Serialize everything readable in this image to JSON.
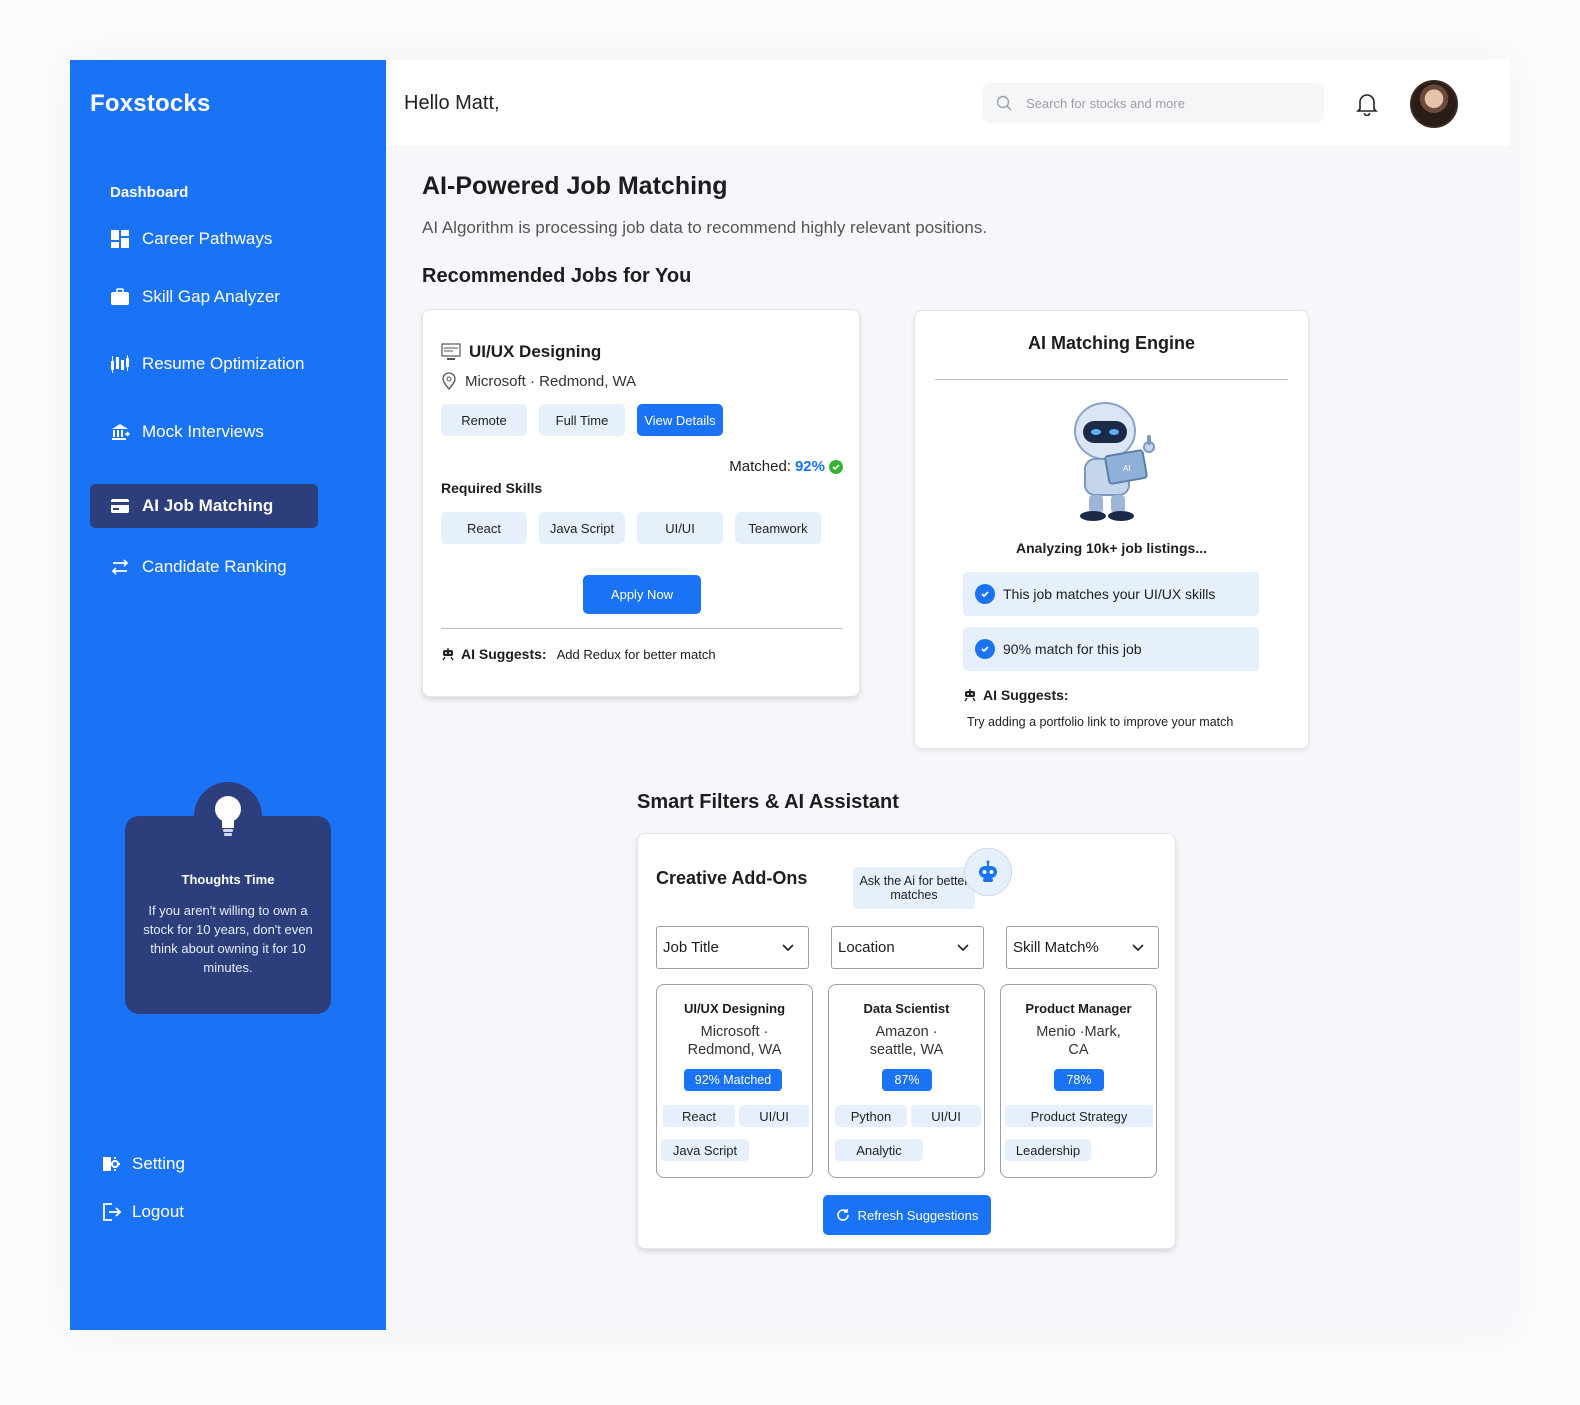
{
  "sidebar": {
    "brand": "Foxstocks",
    "heading": "Dashboard",
    "items": [
      {
        "label": "Career Pathways",
        "icon": "grid-icon"
      },
      {
        "label": "Skill Gap Analyzer",
        "icon": "briefcase-icon"
      },
      {
        "label": "Resume Optimization",
        "icon": "chart-bars-icon"
      },
      {
        "label": "Mock Interviews",
        "icon": "bank-icon"
      },
      {
        "label": "AI Job Matching",
        "icon": "card-icon",
        "active": true
      },
      {
        "label": "Candidate Ranking",
        "icon": "swap-icon"
      }
    ],
    "thoughts": {
      "title": "Thoughts Time",
      "text": "If you aren't willing to own a stock for 10 years, don't even think about owning it for 10 minutes."
    },
    "setting": "Setting",
    "logout": "Logout"
  },
  "header": {
    "greeting": "Hello Matt,",
    "search_placeholder": "Search for stocks and more"
  },
  "main": {
    "title": "AI-Powered Job Matching",
    "subtitle": "AI Algorithm is processing job data to recommend highly relevant positions.",
    "recommended_heading": "Recommended Jobs for You",
    "job": {
      "title": "UI/UX Designing",
      "location": "Microsoft · Redmond, WA",
      "tags": [
        "Remote",
        "Full Time"
      ],
      "view_details": "View Details",
      "matched_label": "Matched:",
      "matched_value": "92%",
      "required_skills_label": "Required Skills",
      "skills": [
        "React",
        "Java Script",
        "UI/UI",
        "Teamwork"
      ],
      "apply": "Apply Now",
      "suggest_label": "AI Suggests:",
      "suggest_text": "Add Redux for better match"
    },
    "engine": {
      "title": "AI Matching Engine",
      "analyzing": "Analyzing 10k+ job listings...",
      "checks": [
        "This job matches your UI/UX skills",
        "90% match for this job"
      ],
      "suggest_label": "AI Suggests:",
      "suggest_text": "Try adding a portfolio link to improve your match"
    },
    "filters_heading": "Smart Filters & AI Assistant",
    "addons": {
      "title": "Creative Add-Ons",
      "ask": "Ask the Ai for better matches",
      "selects": [
        "Job Title",
        "Location",
        "Skill Match%"
      ],
      "cards": [
        {
          "title": "UI/UX Designing",
          "loc1": "Microsoft ·",
          "loc2": "Redmond, WA",
          "badge": "92% Matched",
          "tags": [
            "React",
            "UI/UI",
            "Java Script"
          ]
        },
        {
          "title": "Data Scientist",
          "loc1": "Amazon ·",
          "loc2": "seattle, WA",
          "badge": "87%",
          "tags": [
            "Python",
            "UI/UI",
            "Analytic"
          ]
        },
        {
          "title": "Product Manager",
          "loc1": "Menio ·Mark,",
          "loc2": "CA",
          "badge": "78%",
          "tags": [
            "Product Strategy",
            "Leadership"
          ]
        }
      ],
      "refresh": "Refresh Suggestions"
    }
  },
  "colors": {
    "primary": "#1a73f5",
    "sidebar_active": "#2c3e7c",
    "chip": "#e6f0fc",
    "success": "#34b233"
  }
}
